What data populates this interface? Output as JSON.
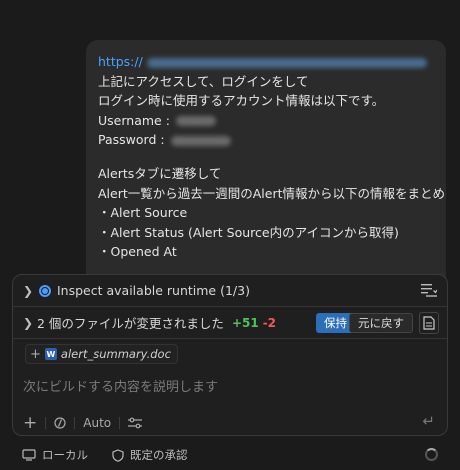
{
  "message": {
    "url_prefix": "https://",
    "line1": "上記にアクセスして、ログインをして",
    "line2": "ログイン時に使用するアカウント情報は以下です。",
    "username_label": "Username :",
    "password_label": "Password :",
    "line3": "Alertsタブに遷移して",
    "line4": "Alert一覧から過去一週間のAlert情報から以下の情報をまとめて",
    "bullets": [
      "・Alert Source",
      "・Alert Status (Alert Source内のアイコンから取得)",
      "・Opened At"
    ]
  },
  "panel": {
    "task_label": "Inspect available runtime (1/3)",
    "changes_label": "2 個のファイルが変更されました",
    "additions": "+51",
    "deletions": "-2",
    "keep_button": "保持",
    "undo_button": "元に戻す",
    "attached_file": "alert_summary.doc",
    "attached_file_badge": "W",
    "prompt_placeholder": "次にビルドする内容を説明します",
    "model_label": "Auto"
  },
  "status_bar": {
    "local_label": "ローカル",
    "approval_label": "既定の承認"
  },
  "colors": {
    "accent": "#2b6fb8",
    "link": "#4aa3ff",
    "additions": "#4fc35a",
    "deletions": "#f05a5a"
  }
}
